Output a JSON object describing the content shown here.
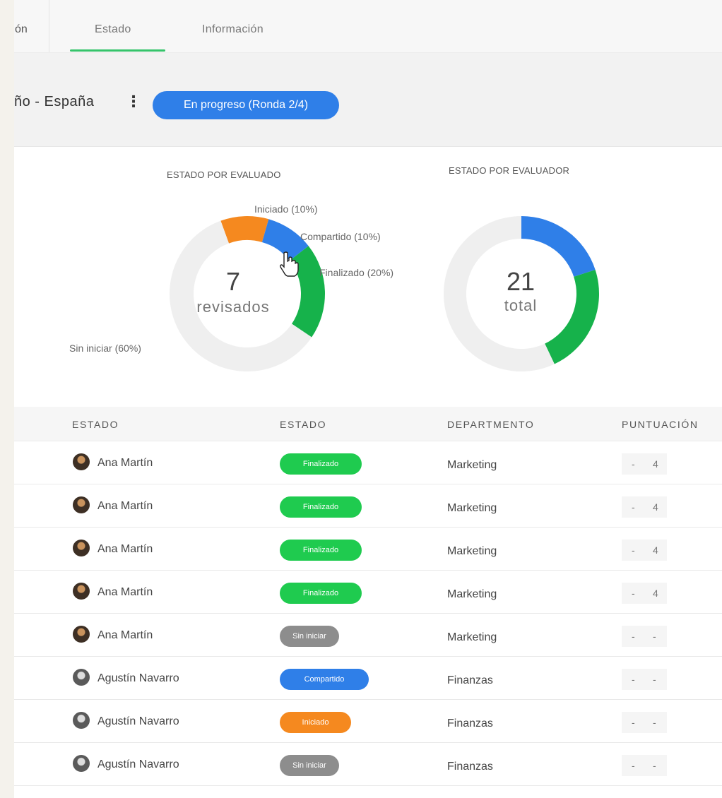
{
  "tabs": {
    "cut_label": "ón",
    "items": [
      "Estado",
      "Información"
    ],
    "active_index": 0
  },
  "header": {
    "title": "ño - España",
    "status_pill": "En progreso (Ronda 2/4)"
  },
  "charts": {
    "evaluado": {
      "title": "ESTADO POR EVALUADO",
      "center_value": "7",
      "center_label": "revisados",
      "segments": [
        {
          "label": "Iniciado (10%)",
          "value": 10,
          "color": "#f5891f"
        },
        {
          "label": "Compartido (10%)",
          "value": 10,
          "color": "#2f7fe8"
        },
        {
          "label": "Finalizado (20%)",
          "value": 20,
          "color": "#16b24b"
        },
        {
          "label": "Sin iniciar (60%)",
          "value": 60,
          "color": "#efefef"
        }
      ]
    },
    "evaluador": {
      "title": "ESTADO POR EVALUADOR",
      "center_value": "21",
      "center_label": "total",
      "segments": [
        {
          "value": 20,
          "color": "#2f7fe8"
        },
        {
          "value": 23,
          "color": "#16b24b"
        },
        {
          "value": 57,
          "color": "#efefef"
        }
      ]
    }
  },
  "table": {
    "headers": [
      "ESTADO",
      "ESTADO",
      "DEPARTMENTO",
      "PUNTUACIÓN"
    ],
    "rows": [
      {
        "name": "Ana Martín",
        "avatar": "female",
        "status": "Finalizado",
        "status_color": "#1fcb4f",
        "department": "Marketing",
        "score_a": "-",
        "score_b": "4"
      },
      {
        "name": "Ana Martín",
        "avatar": "female",
        "status": "Finalizado",
        "status_color": "#1fcb4f",
        "department": "Marketing",
        "score_a": "-",
        "score_b": "4"
      },
      {
        "name": "Ana Martín",
        "avatar": "female",
        "status": "Finalizado",
        "status_color": "#1fcb4f",
        "department": "Marketing",
        "score_a": "-",
        "score_b": "4"
      },
      {
        "name": "Ana Martín",
        "avatar": "female",
        "status": "Finalizado",
        "status_color": "#1fcb4f",
        "department": "Marketing",
        "score_a": "-",
        "score_b": "4"
      },
      {
        "name": "Ana Martín",
        "avatar": "female",
        "status": "Sin iniciar",
        "status_color": "#8d8d8d",
        "department": "Marketing",
        "score_a": "-",
        "score_b": "-"
      },
      {
        "name": "Agustín Navarro",
        "avatar": "male",
        "status": "Compartido",
        "status_color": "#2f7fe8",
        "department": "Finanzas",
        "score_a": "-",
        "score_b": "-"
      },
      {
        "name": "Agustín Navarro",
        "avatar": "male",
        "status": "Iniciado",
        "status_color": "#f5891f",
        "department": "Finanzas",
        "score_a": "-",
        "score_b": "-"
      },
      {
        "name": "Agustín Navarro",
        "avatar": "male",
        "status": "Sin iniciar",
        "status_color": "#8d8d8d",
        "department": "Finanzas",
        "score_a": "-",
        "score_b": "-"
      }
    ]
  }
}
